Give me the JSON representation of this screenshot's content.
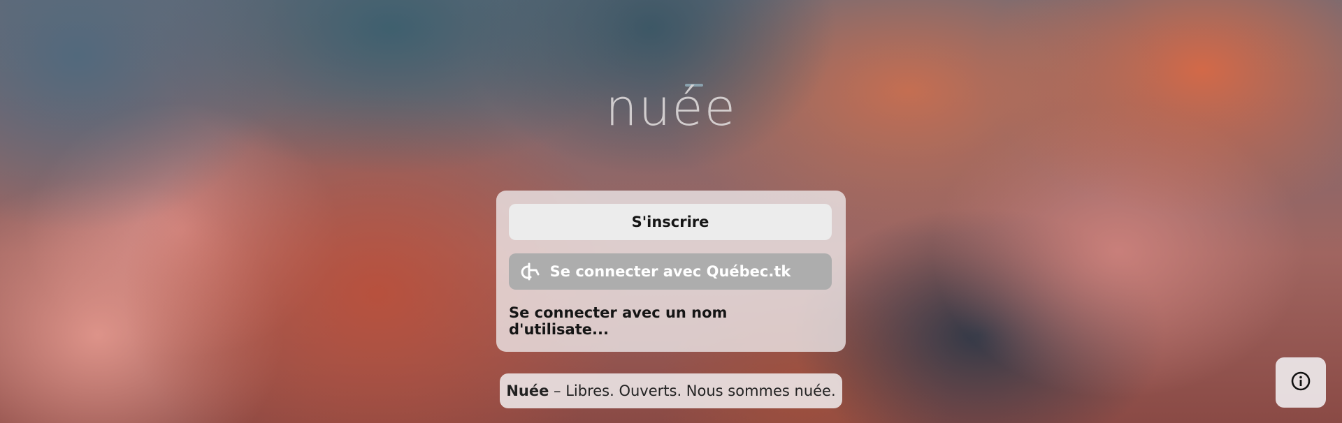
{
  "app": {
    "logo_text": "nuée"
  },
  "auth": {
    "signup_label": "S'inscrire",
    "quebec_login_label": "Se connecter avec Québec.tk",
    "username_login_label": "Se connecter avec un nom d'utilisate..."
  },
  "footer": {
    "brand": "Nuée",
    "separator": " – ",
    "slogan": "Libres. Ouverts. Nous sommes nuée."
  },
  "icons": {
    "quebec": "quebec-tk-icon",
    "info": "info-icon"
  },
  "colors": {
    "primary_button": "#ececec",
    "secondary_button": "#adadad",
    "logo_accent": "#8aa2ae"
  }
}
